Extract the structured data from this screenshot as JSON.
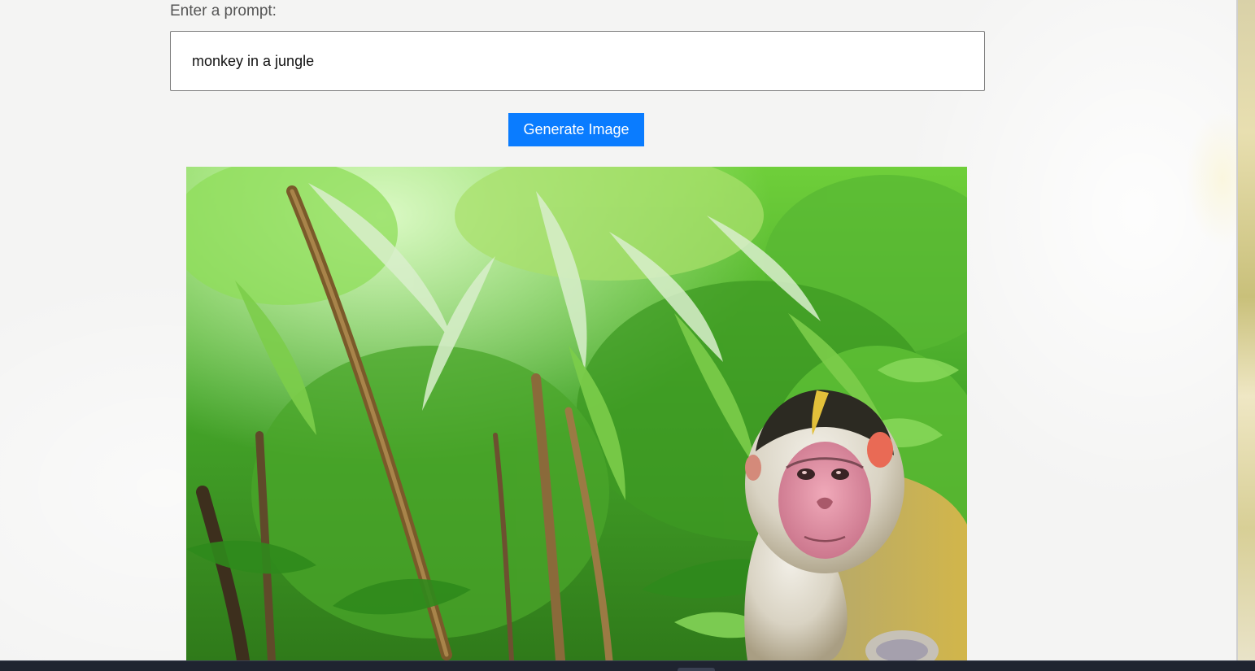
{
  "form": {
    "prompt_label": "Enter a prompt:",
    "prompt_value": "monkey in a jungle",
    "generate_button_label": "Generate Image"
  },
  "generated_image": {
    "subject": "monkey in a jungle"
  },
  "colors": {
    "button_bg": "#0a7cff",
    "button_text": "#ffffff",
    "page_bg": "#f4f4f3",
    "taskbar_bg": "#1f2430"
  },
  "icons": []
}
